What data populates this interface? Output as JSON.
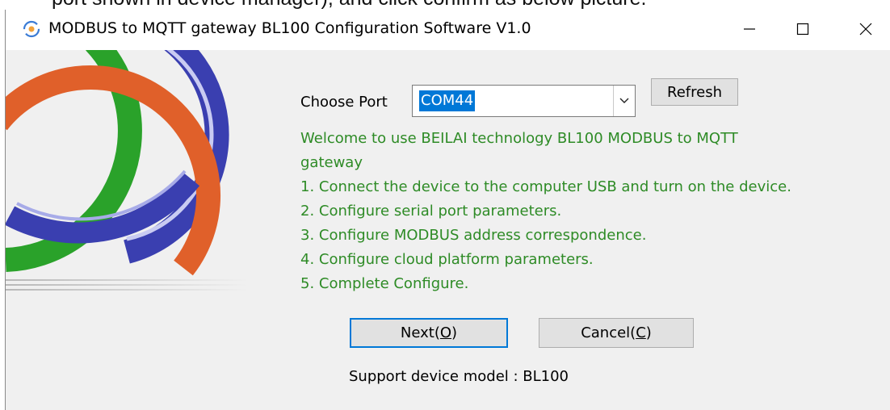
{
  "document": {
    "partial_text": "port shown in device manager), and click confirm as below picture."
  },
  "window": {
    "title": "MODBUS to MQTT gateway BL100 Configuration Software V1.0",
    "icons": {
      "app": "app-logo-icon",
      "minimize": "minimize-icon",
      "maximize": "maximize-icon",
      "close": "close-icon"
    }
  },
  "form": {
    "port_label": "Choose Port",
    "port_value": "COM44",
    "refresh_label": "Refresh",
    "dropdown_icon": "chevron-down-icon"
  },
  "welcome": {
    "line1": "Welcome to use BEILAI technology BL100 MODBUS to MQTT",
    "line2": "gateway",
    "steps": [
      "1. Connect the device to the computer USB and turn on the device.",
      "2. Configure serial port parameters.",
      "3. Configure MODBUS address correspondence.",
      "4. Configure cloud platform parameters.",
      "5. Complete Configure."
    ]
  },
  "buttons": {
    "next_text": "Next(",
    "next_key": "O",
    "next_close": ")",
    "cancel_text": "Cancel(",
    "cancel_key": "C",
    "cancel_close": ")"
  },
  "footer": {
    "support": "Support device model : BL100"
  },
  "colors": {
    "accent": "#0078d7",
    "welcome_text": "#2e8b26",
    "client_bg": "#f0f0f0",
    "ring_green": "#2aa22a",
    "ring_blue": "#3a3fb0",
    "ring_orange": "#e0602a"
  }
}
